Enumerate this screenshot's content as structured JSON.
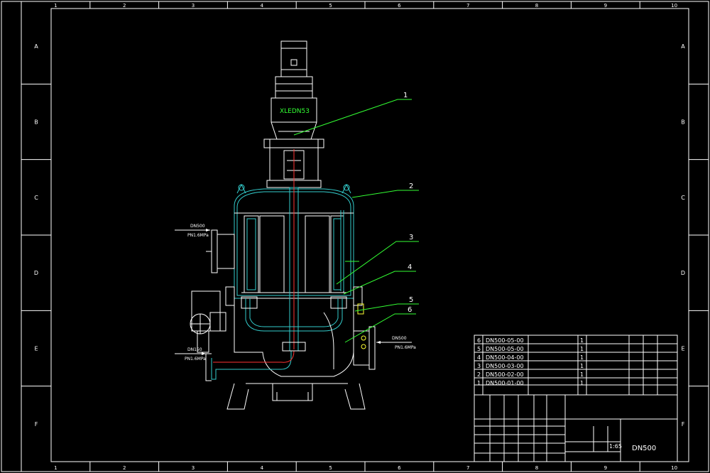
{
  "colors": {
    "background": "#000000",
    "frame": "#ffffff",
    "leader": "#33ff33",
    "vessel": "#33cccc",
    "pipe_core": "#ff3333",
    "inner": "#ffffff"
  },
  "border": {
    "columns": [
      "1",
      "2",
      "3",
      "4",
      "5",
      "6",
      "7",
      "8",
      "9",
      "10"
    ],
    "rows": [
      "A",
      "B",
      "C",
      "D",
      "E",
      "F"
    ]
  },
  "motor_label": "XLEDN53",
  "leaders": [
    "1",
    "2",
    "3",
    "4",
    "5",
    "6"
  ],
  "dims": {
    "inlet_label": "DN500",
    "inlet_pressure": "PN1.6MPa",
    "drain_label": "DN150",
    "drain_pressure": "PN1.6MPa",
    "outlet_label": "DN500",
    "outlet_pressure": "PN1.6MPa"
  },
  "parts_list": [
    {
      "no": "6",
      "code": "DN500-05-00",
      "qty": "1"
    },
    {
      "no": "5",
      "code": "DN500-05-00",
      "qty": "1"
    },
    {
      "no": "4",
      "code": "DN500-04-00",
      "qty": "1"
    },
    {
      "no": "3",
      "code": "DN500-03-00",
      "qty": "1"
    },
    {
      "no": "2",
      "code": "DN500-02-00",
      "qty": "1"
    },
    {
      "no": "1",
      "code": "DN500-01-00",
      "qty": "1"
    }
  ],
  "title_block": {
    "model": "DN500",
    "scale": "1:65"
  }
}
